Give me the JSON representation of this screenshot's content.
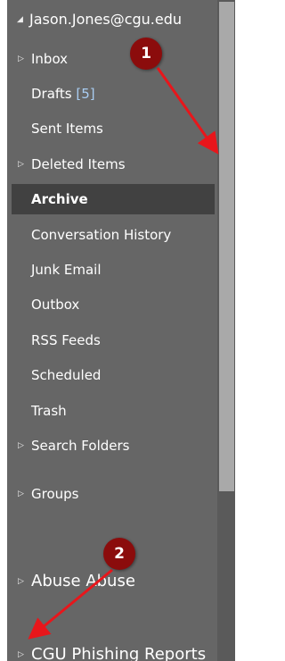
{
  "account": {
    "caret_icon": "triangle-down-icon",
    "label": "Jason.Jones@cgu.edu"
  },
  "folders": [
    {
      "key": "inbox",
      "label": "Inbox",
      "expandable": true
    },
    {
      "key": "drafts",
      "label": "Drafts",
      "count": "[5]",
      "expandable": false
    },
    {
      "key": "sent",
      "label": "Sent Items",
      "expandable": false
    },
    {
      "key": "deleted",
      "label": "Deleted Items",
      "expandable": true
    },
    {
      "key": "archive",
      "label": "Archive",
      "expandable": false,
      "selected": true
    },
    {
      "key": "conversation-history",
      "label": "Conversation History",
      "expandable": false
    },
    {
      "key": "junk",
      "label": "Junk Email",
      "expandable": false
    },
    {
      "key": "outbox",
      "label": "Outbox",
      "expandable": false
    },
    {
      "key": "rss",
      "label": "RSS Feeds",
      "expandable": false
    },
    {
      "key": "scheduled",
      "label": "Scheduled",
      "expandable": false
    },
    {
      "key": "trash",
      "label": "Trash",
      "expandable": false
    },
    {
      "key": "search-folders",
      "label": "Search Folders",
      "expandable": true
    }
  ],
  "groups": {
    "label": "Groups"
  },
  "mailboxes": [
    {
      "key": "abuse",
      "label": "Abuse Abuse"
    },
    {
      "key": "phishing",
      "label": "CGU Phishing Reports"
    }
  ],
  "annotations": [
    {
      "number": "1",
      "color": "#8b0c0c"
    },
    {
      "number": "2",
      "color": "#8b0c0c"
    }
  ],
  "colors": {
    "pane_background": "#666666",
    "selected_background": "#414141",
    "text": "#ffffff",
    "count": "#a9cdf2",
    "arrow": "#e8161b"
  }
}
